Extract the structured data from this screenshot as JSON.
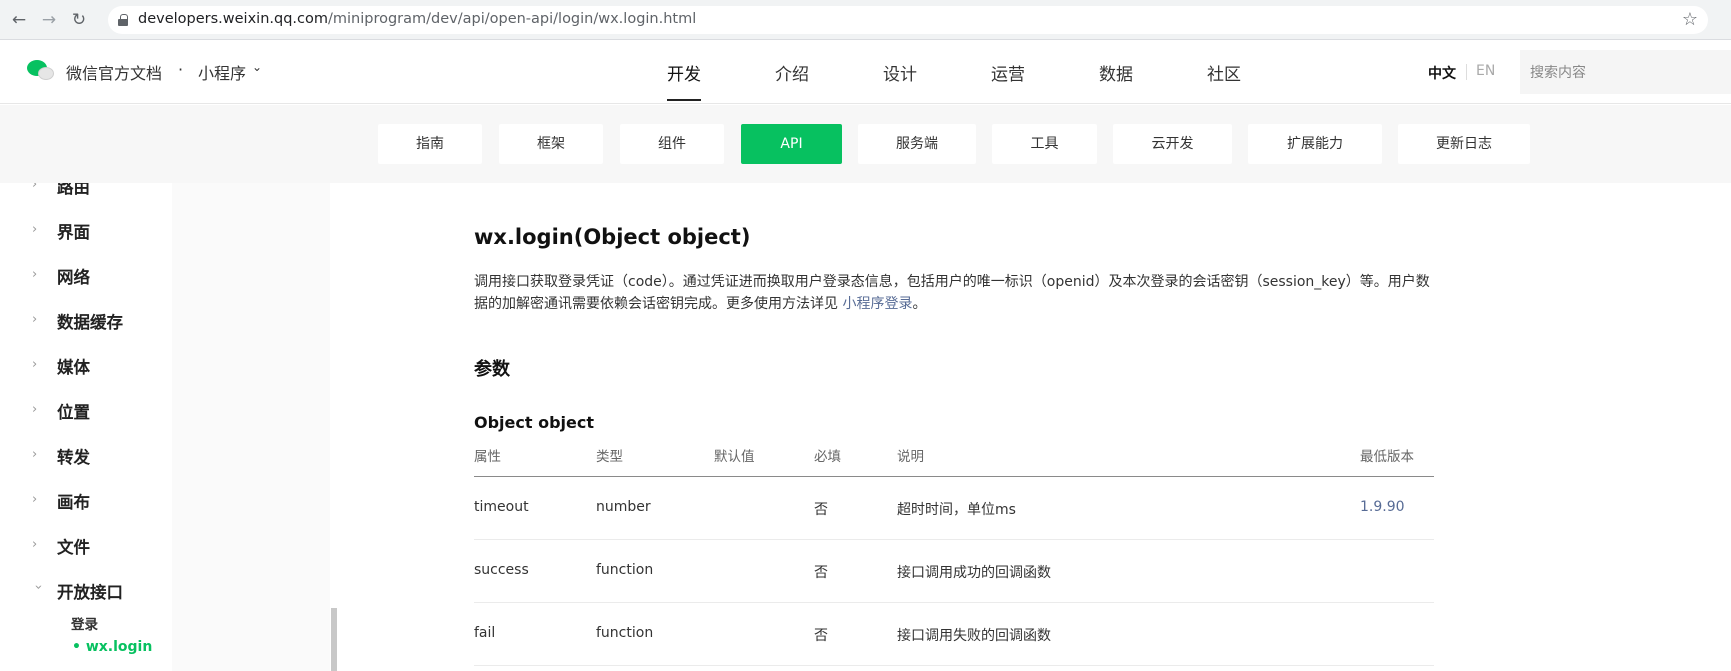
{
  "browser": {
    "url_host": "developers.weixin.qq.com",
    "url_path": "/miniprogram/dev/api/open-api/login/wx.login.html"
  },
  "header": {
    "brand": "微信官方文档",
    "dot": "·",
    "product": "小程序",
    "nav": [
      "开发",
      "介绍",
      "设计",
      "运营",
      "数据",
      "社区"
    ],
    "lang_zh": "中文",
    "lang_en": "EN",
    "search_placeholder": "搜索内容"
  },
  "subnav": [
    "指南",
    "框架",
    "组件",
    "API",
    "服务端",
    "工具",
    "云开发",
    "扩展能力",
    "更新日志"
  ],
  "sidebar": {
    "items": [
      "路由",
      "界面",
      "网络",
      "数据缓存",
      "媒体",
      "位置",
      "转发",
      "画布",
      "文件",
      "开放接口"
    ],
    "sub_heading": "登录",
    "active_item": "wx.login"
  },
  "content": {
    "title": "wx.login(Object object)",
    "desc_text": "调用接口获取登录凭证（code）。通过凭证进而换取用户登录态信息，包括用户的唯一标识（openid）及本次登录的会话密钥（session_key）等。用户数据的加解密通讯需要依赖会话密钥完成。更多使用方法详见 ",
    "desc_link": "小程序登录",
    "desc_end": "。",
    "params_heading": "参数",
    "object_heading": "Object object",
    "table": {
      "headers": [
        "属性",
        "类型",
        "默认值",
        "必填",
        "说明",
        "最低版本"
      ],
      "rows": [
        [
          "timeout",
          "number",
          "",
          "否",
          "超时时间，单位ms",
          "1.9.90"
        ],
        [
          "success",
          "function",
          "",
          "否",
          "接口调用成功的回调函数",
          ""
        ],
        [
          "fail",
          "function",
          "",
          "否",
          "接口调用失败的回调函数",
          ""
        ]
      ]
    }
  }
}
